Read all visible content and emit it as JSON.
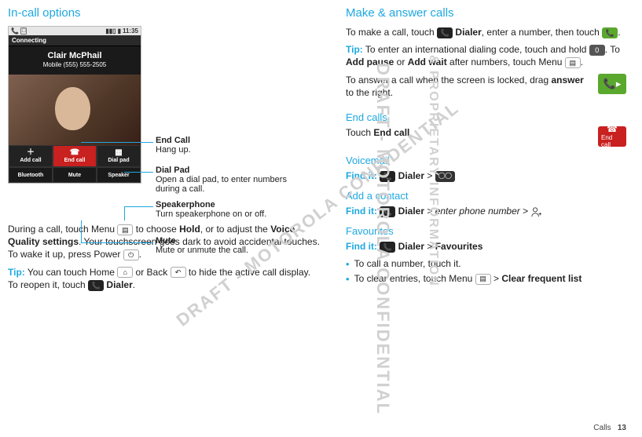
{
  "left": {
    "title": "In-call options",
    "statusbar": {
      "time": "11:35"
    },
    "banner": "Connecting",
    "caller": {
      "name": "Clair McPhail",
      "number": "Mobile (555) 555-2505"
    },
    "buttons": {
      "addcall": "Add call",
      "endcall": "End call",
      "dialpad": "Dial pad",
      "bluetooth": "Bluetooth",
      "mute": "Mute",
      "speaker": "Speaker"
    },
    "labels": {
      "endcall_t": "End Call",
      "endcall_d": "Hang up.",
      "dialpad_t": "Dial Pad",
      "dialpad_d": "Open a dial pad, to enter numbers during a call.",
      "speaker_t": "Speakerphone",
      "speaker_d": "Turn speakerphone on or off.",
      "mute_t": "Mute",
      "mute_d": "Mute or unmute the call."
    },
    "para1_a": "During a call, touch Menu ",
    "para1_b": " to choose ",
    "para1_hold": "Hold",
    "para1_c": ", or to adjust the ",
    "para1_vq": "Voice Quality settings",
    "para1_d": ". Your touchscreen goes dark to avoid accidental touches. To wake it up, press Power ",
    "para1_e": ".",
    "tip_lead": "Tip:",
    "tip_a": " You can touch Home ",
    "tip_b": " or Back ",
    "tip_c": " to hide the active call display. To reopen it, touch ",
    "tip_dialer": " Dialer",
    "tip_d": "."
  },
  "right": {
    "make_title": "Make & answer calls",
    "make_a": "To make a call, touch ",
    "make_dialer": " Dialer",
    "make_b": ", enter a number, then touch ",
    "make_c": ".",
    "tip_lead": "Tip:",
    "tip2_a": " To enter an international dialing code, touch and hold ",
    "tip2_zero": "0",
    "tip2_b": ". To ",
    "tip2_addpause": "Add pause",
    "tip2_c": " or ",
    "tip2_addwait": "Add wait",
    "tip2_d": " after numbers, touch Menu ",
    "tip2_e": ".",
    "answer_a": "To answer a call when the screen is locked, drag ",
    "answer_bold": "answer",
    "answer_b": " to the right.",
    "end_title": "End calls",
    "end_a": "Touch ",
    "end_bold": "End call",
    "end_b": ".",
    "vm_title": "Voicemail",
    "findit": "Find it:",
    "vm_dialer": " Dialer",
    "gt": " > ",
    "addc_title": "Add a contact",
    "addc_dialer": " Dialer",
    "addc_b": "enter phone number",
    "fav_title": "Favourites",
    "fav_dialer": " Dialer",
    "fav_bold": "Favourites",
    "bul1": "To call a number, touch it.",
    "bul2_a": "To clear entries, touch Menu ",
    "bul2_b": " > ",
    "bul2_bold": "Clear frequent list"
  },
  "watermark": {
    "w1": "DRAFT - MOTOROLA CONFIDENTIAL",
    "w2": "& PROPRIETARY INFORMATION",
    "w3": "DRAFT - MOTOROLA CONFIDENTIAL"
  },
  "footer": {
    "label": "Calls",
    "page": "13"
  },
  "icons": {
    "phone": "📞"
  }
}
